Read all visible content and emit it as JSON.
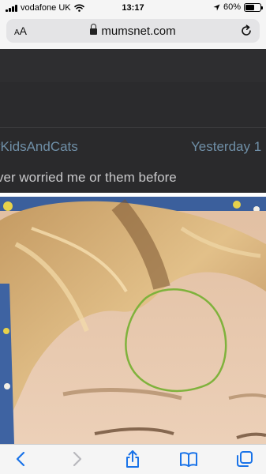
{
  "status_bar": {
    "carrier": "vodafone UK",
    "time": "13:17",
    "battery_percent": "60%",
    "battery_level": 0.6
  },
  "address_bar": {
    "text_size_label_small": "A",
    "text_size_label_large": "A",
    "url": "mumsnet.com"
  },
  "post": {
    "poster_name": "yKidsAndCats",
    "date": "Yesterday 1",
    "text": "ver worried me or them before"
  },
  "colors": {
    "link": "#6f8fa7",
    "highlight_circle": "#7fb23c",
    "toolbar_icon": "#1a73e8"
  },
  "toolbar": {
    "icons": [
      "back-icon",
      "forward-icon",
      "share-icon",
      "bookmarks-icon",
      "tabs-icon"
    ]
  }
}
